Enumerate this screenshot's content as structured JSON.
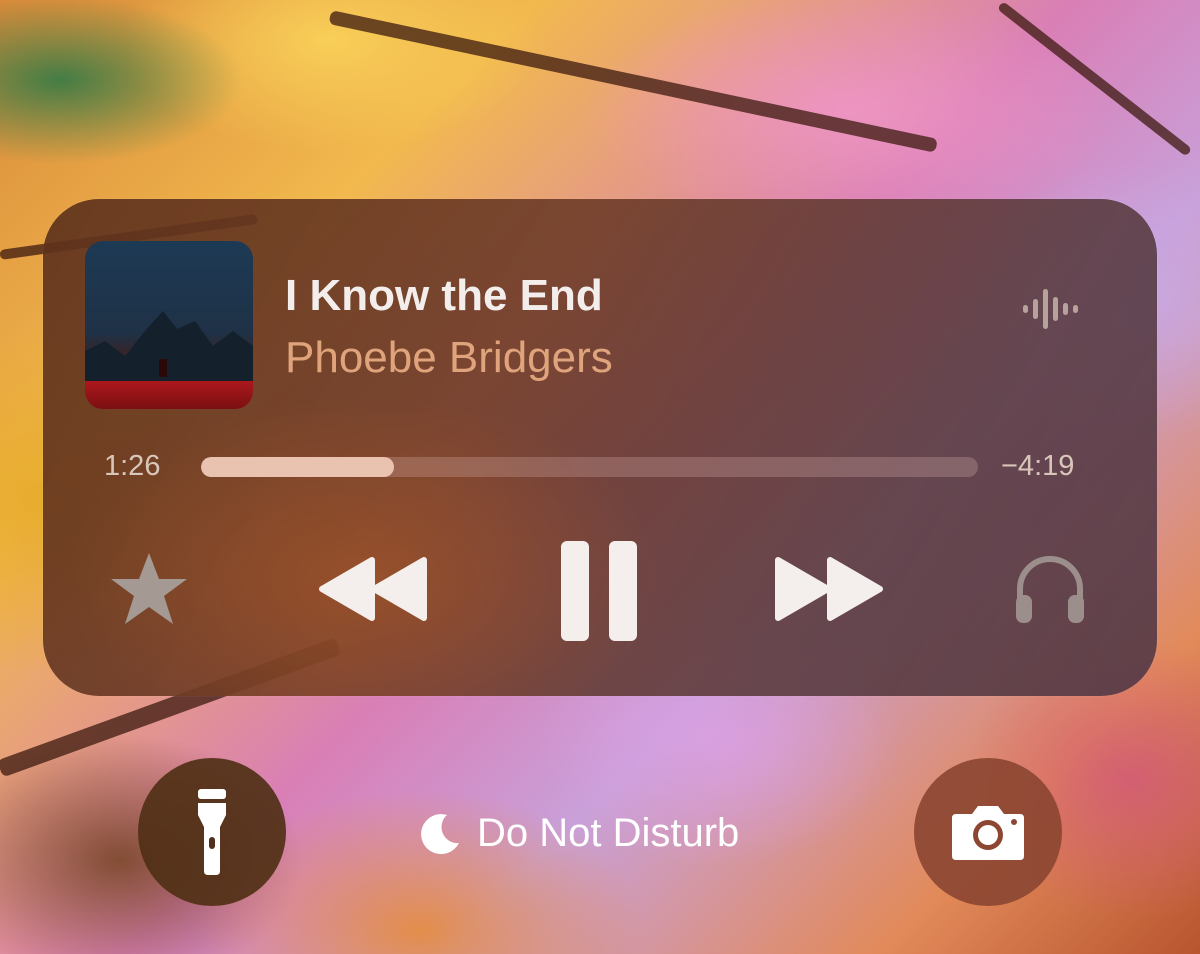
{
  "now_playing": {
    "title": "I Know the End",
    "artist": "Phoebe Bridgers",
    "elapsed": "1:26",
    "remaining": "−4:19",
    "progress": 0.248,
    "output_icon": "airplay-waveform-icon"
  },
  "controls": {
    "favorite_icon": "star-icon",
    "previous_icon": "rewind-icon",
    "play_state_icon": "pause-icon",
    "next_icon": "fast-forward-icon",
    "audio_route_icon": "headphones-icon"
  },
  "lock_screen": {
    "left_button_icon": "flashlight-icon",
    "focus_mode_icon": "moon-icon",
    "focus_mode_label": "Do Not Disturb",
    "right_button_icon": "camera-icon"
  },
  "colors": {
    "title": "#f3eeec",
    "artist": "#e0a47c",
    "scrubber_fill": "#e9c2b0"
  }
}
